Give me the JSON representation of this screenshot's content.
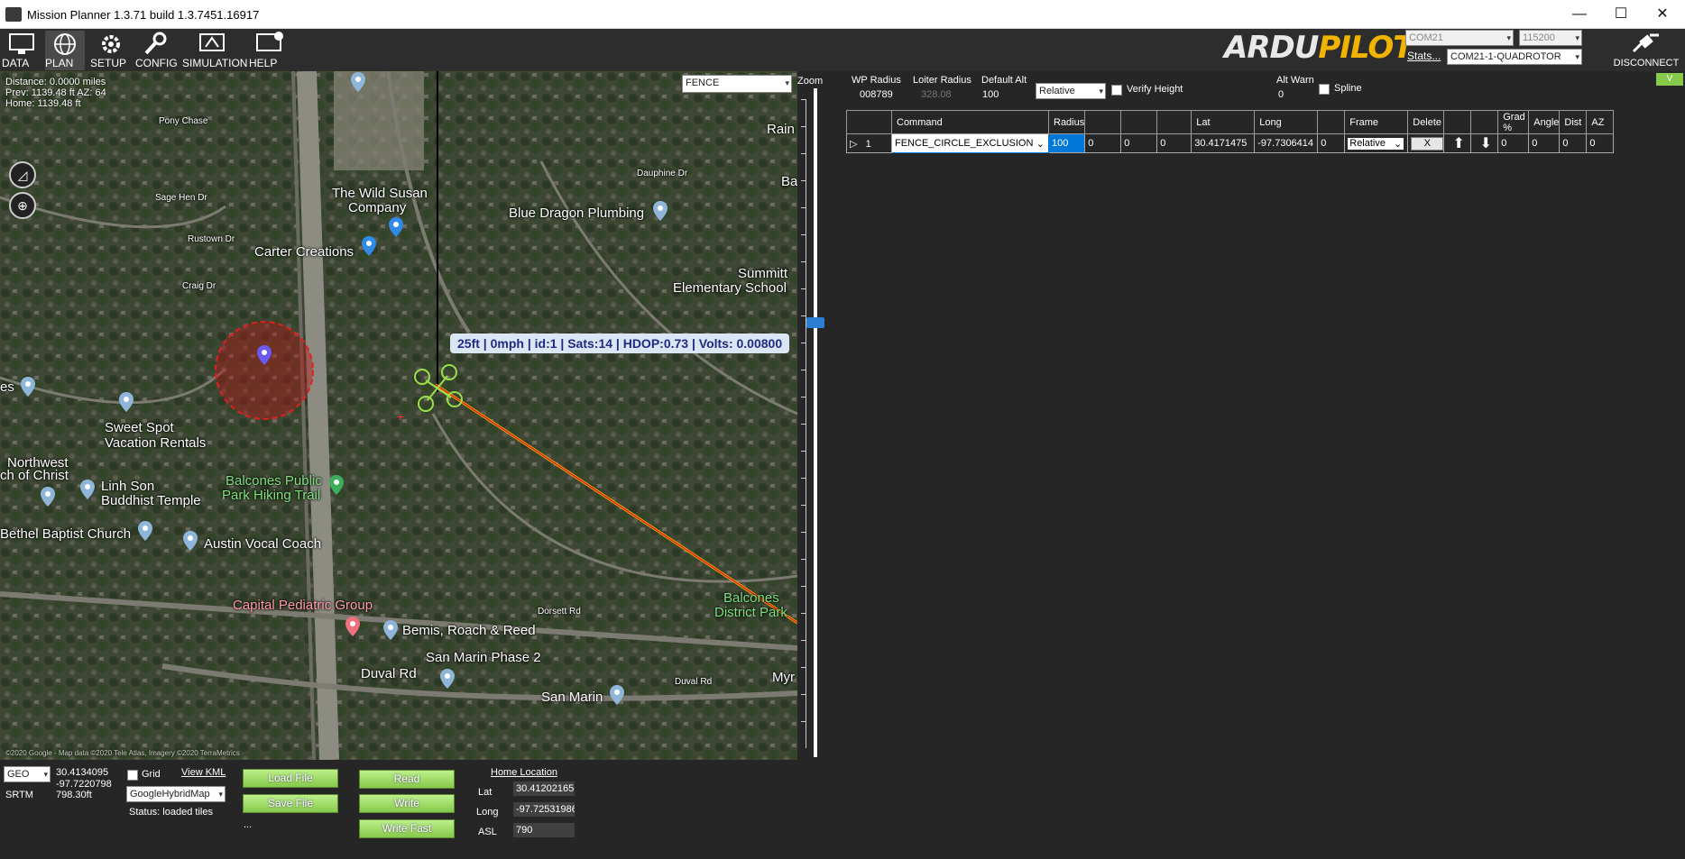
{
  "window": {
    "title": "Mission Planner 1.3.71 build 1.3.7451.16917",
    "minimize": "—",
    "maximize": "☐",
    "close": "✕"
  },
  "toolbar": {
    "items": [
      {
        "label": "DATA",
        "icon": "monitor-icon"
      },
      {
        "label": "PLAN",
        "icon": "globe-icon"
      },
      {
        "label": "SETUP",
        "icon": "gear-icon"
      },
      {
        "label": "CONFIG",
        "icon": "wrench-icon"
      },
      {
        "label": "SIMULATION",
        "icon": "simulation-icon"
      },
      {
        "label": "HELP",
        "icon": "help-icon"
      }
    ],
    "active": "PLAN"
  },
  "connection": {
    "port": "COM21",
    "baud": "115200",
    "stats": "Stats...",
    "profile": "COM21-1-QUADROTOR",
    "disconnect": "DISCONNECT"
  },
  "logo": {
    "part1": "ARDU",
    "part2": "PILOT"
  },
  "map": {
    "distance": "Distance: 0.0000 miles",
    "prev": "Prev: 1139.48 ft AZ: 64",
    "home": "Home: 1139.48 ft",
    "layer": "FENCE",
    "zoom_label": "Zoom",
    "vehicle_label": "25ft | 0mph | id:1 | Sats:14 | HDOP:0.73 | Volts: 0.00800",
    "copyright": "©2020 Google - Map data ©2020 Tele Atlas, Imagery ©2020 TerraMetrics",
    "places": [
      {
        "text": "Pony Chase",
        "cls": "sm"
      },
      {
        "text": "Sage Hen Dr",
        "cls": "sm"
      },
      {
        "text": "Rustown Dr",
        "cls": "sm"
      },
      {
        "text": "Craig Dr",
        "cls": "sm"
      },
      {
        "text": "The Wild Susan",
        "cls": ""
      },
      {
        "text": "Company",
        "cls": ""
      },
      {
        "text": "Carter Creations",
        "cls": ""
      },
      {
        "text": "Blue Dragon Plumbing",
        "cls": ""
      },
      {
        "text": "Summitt",
        "cls": ""
      },
      {
        "text": "Elementary School",
        "cls": ""
      },
      {
        "text": "Rain",
        "cls": ""
      },
      {
        "text": "Ba",
        "cls": ""
      },
      {
        "text": "Dauphine Dr",
        "cls": "sm"
      },
      {
        "text": "Sweet Spot",
        "cls": ""
      },
      {
        "text": "Vacation Rentals",
        "cls": ""
      },
      {
        "text": "Northwest",
        "cls": ""
      },
      {
        "text": "ch of Christ",
        "cls": ""
      },
      {
        "text": "Linh Son",
        "cls": ""
      },
      {
        "text": "Buddhist Temple",
        "cls": ""
      },
      {
        "text": "Balcones Public",
        "cls": "green"
      },
      {
        "text": "Park Hiking Trail",
        "cls": "green"
      },
      {
        "text": "Bethel Baptist Church",
        "cls": ""
      },
      {
        "text": "Austin Vocal Coach",
        "cls": ""
      },
      {
        "text": "Capital Pediatric Group",
        "cls": "pink"
      },
      {
        "text": "Bemis, Roach & Reed",
        "cls": ""
      },
      {
        "text": "San Marin Phase 2",
        "cls": ""
      },
      {
        "text": "Duval Rd",
        "cls": ""
      },
      {
        "text": "San Marin",
        "cls": ""
      },
      {
        "text": "Balcones",
        "cls": "green"
      },
      {
        "text": "District Park",
        "cls": "green"
      },
      {
        "text": "Myr",
        "cls": ""
      },
      {
        "text": "Dorsett Rd",
        "cls": "sm"
      },
      {
        "text": "Duval Rd",
        "cls": "sm"
      },
      {
        "text": "es",
        "cls": ""
      }
    ]
  },
  "wp": {
    "wp_radius_label": "WP Radius",
    "wp_radius": "008789",
    "loiter_radius_label": "Loiter Radius",
    "loiter_radius": "328.08",
    "default_alt_label": "Default Alt",
    "default_alt": "100",
    "frame": "Relative",
    "verify_height": "Verify Height",
    "alt_warn_label": "Alt Warn",
    "alt_warn": "0",
    "spline": "Spline",
    "v_button": "V"
  },
  "grid": {
    "headers": [
      "",
      "Command",
      "Radius",
      "",
      "",
      "",
      "Lat",
      "Long",
      "",
      "Frame",
      "Delete",
      "",
      "",
      "Grad %",
      "Angle",
      "Dist",
      "AZ"
    ],
    "row": {
      "arrow": "▷",
      "index": "1",
      "command": "FENCE_CIRCLE_EXCLUSION",
      "radius": "100",
      "p2": "0",
      "p3": "0",
      "p4": "0",
      "lat": "30.4171475",
      "long": "-97.7306414",
      "alt": "0",
      "frame": "Relative",
      "delete": "X",
      "grad": "0",
      "angle": "0",
      "dist": "0",
      "az": "0"
    }
  },
  "bottom": {
    "coord_type": "GEO",
    "lat": "30.4134095",
    "lng": "-97.7220798",
    "srtm_label": "SRTM",
    "alt": "798.30ft",
    "grid_label": "Grid",
    "view_kml": "View KML",
    "map_type": "GoogleHybridMap",
    "status": "Status: loaded tiles",
    "ellipsis": "...",
    "load_file": "Load File",
    "save_file": "Save File",
    "read": "Read",
    "write": "Write",
    "write_fast": "Write Fast",
    "home_location": "Home Location",
    "home_lat_label": "Lat",
    "home_lat": "30.41202165",
    "home_long_label": "Long",
    "home_long": "-97.72531986",
    "home_asl_label": "ASL",
    "home_asl": "790"
  }
}
